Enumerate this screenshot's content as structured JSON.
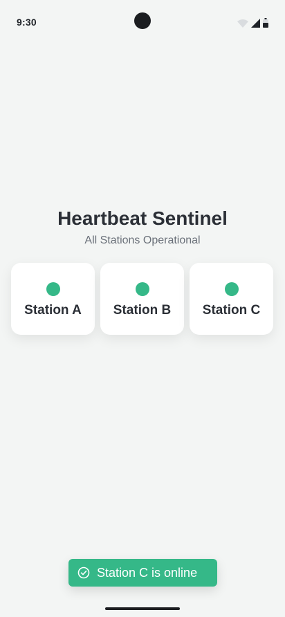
{
  "status_bar": {
    "time": "9:30",
    "icons": [
      "wifi-icon",
      "cell-signal-icon",
      "battery-icon"
    ]
  },
  "header": {
    "title": "Heartbeat Sentinel",
    "subtitle": "All Stations Operational"
  },
  "stations": [
    {
      "name": "Station A",
      "status": "online"
    },
    {
      "name": "Station B",
      "status": "online"
    },
    {
      "name": "Station C",
      "status": "online"
    }
  ],
  "toast": {
    "icon": "check-circle-icon",
    "message": "Station C is online"
  },
  "colors": {
    "background": "#f3f5f4",
    "online": "#35b888",
    "toast": "#35b888",
    "title": "#2b2f36",
    "subtitle": "#6a7079"
  }
}
